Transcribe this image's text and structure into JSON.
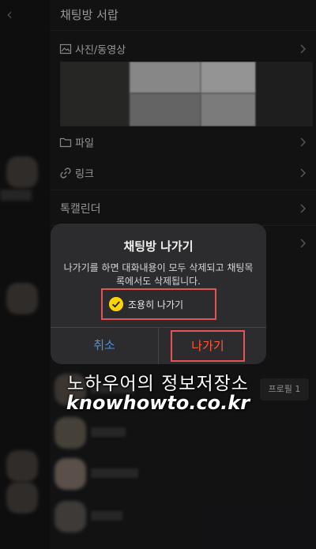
{
  "drawer": {
    "title": "채팅방 서랍",
    "items": [
      {
        "label": "사진/동영상",
        "icon": "photo-icon"
      },
      {
        "label": "파일",
        "icon": "folder-icon"
      },
      {
        "label": "링크",
        "icon": "link-icon"
      },
      {
        "label": "톡캘린더",
        "icon": ""
      }
    ]
  },
  "members": {
    "profile_badge": "프로필 1"
  },
  "dialog": {
    "title": "채팅방 나가기",
    "message": "나가기를 하면 대화내용이 모두 삭제되고 채팅목록에서도 삭제됩니다.",
    "quiet_leave_label": "조용히 나가기",
    "quiet_leave_checked": true,
    "cancel_label": "취소",
    "leave_label": "나가기"
  },
  "watermark": {
    "line1": "노하우어의 정보저장소",
    "line2": "knowhowto.co.kr"
  },
  "colors": {
    "accent_blue": "#4a90e2",
    "leave_red": "#ff5a3a",
    "highlight_box": "#e05555",
    "check_yellow": "#ffd400"
  }
}
